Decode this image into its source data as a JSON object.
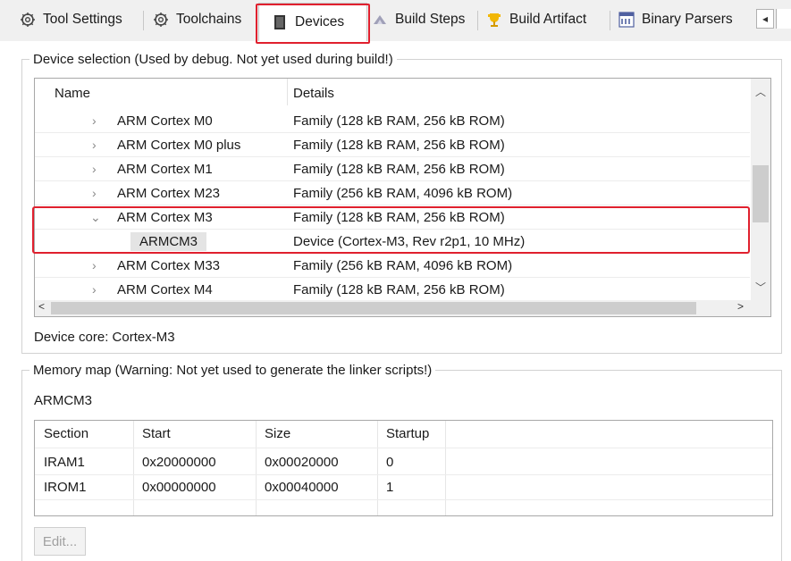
{
  "tabs": [
    {
      "label": "Tool Settings",
      "icon": "gear-icon"
    },
    {
      "label": "Toolchains",
      "icon": "gear-icon"
    },
    {
      "label": "Devices",
      "icon": "chip-icon",
      "active": true
    },
    {
      "label": "Build Steps",
      "icon": "build-steps-icon"
    },
    {
      "label": "Build Artifact",
      "icon": "trophy-icon"
    },
    {
      "label": "Binary Parsers",
      "icon": "binary-icon"
    }
  ],
  "tab_scroll_label": "◂",
  "device_selection": {
    "legend": "Device selection (Used by debug. Not yet used during build!)",
    "columns": {
      "name": "Name",
      "details": "Details"
    },
    "rows": [
      {
        "name": "ARM Cortex M0",
        "details": "Family (128 kB RAM, 256 kB ROM)",
        "expanded": false
      },
      {
        "name": "ARM Cortex M0 plus",
        "details": "Family (128 kB RAM, 256 kB ROM)",
        "expanded": false
      },
      {
        "name": "ARM Cortex M1",
        "details": "Family (128 kB RAM, 256 kB ROM)",
        "expanded": false
      },
      {
        "name": "ARM Cortex M23",
        "details": "Family (256 kB RAM, 4096 kB ROM)",
        "expanded": false
      },
      {
        "name": "ARM Cortex M3",
        "details": "Family (128 kB RAM, 256 kB ROM)",
        "expanded": true
      },
      {
        "name": "ARMCM3",
        "details": "Device (Cortex-M3, Rev r2p1, 10 MHz)",
        "child": true
      },
      {
        "name": "ARM Cortex M33",
        "details": "Family (256 kB RAM, 4096 kB ROM)",
        "expanded": false
      },
      {
        "name": "ARM Cortex M4",
        "details": "Family (128 kB RAM, 256 kB ROM)",
        "expanded": false
      }
    ],
    "device_core": "Device core: Cortex-M3"
  },
  "memory_map": {
    "legend": "Memory map (Warning: Not yet used to generate the linker scripts!)",
    "device": "ARMCM3",
    "columns": [
      "Section",
      "Start",
      "Size",
      "Startup"
    ],
    "rows": [
      [
        "IRAM1",
        "0x20000000",
        "0x00020000",
        "0"
      ],
      [
        "IROM1",
        "0x00000000",
        "0x00040000",
        "1"
      ]
    ],
    "edit_label": "Edit..."
  },
  "colors": {
    "highlight": "#e0202e",
    "selected_child_bg": "#e4e4e4"
  }
}
